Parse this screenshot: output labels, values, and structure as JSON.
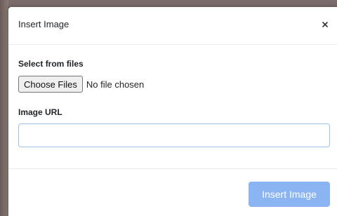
{
  "dialog": {
    "title": "Insert Image",
    "close_icon": "close-icon"
  },
  "files": {
    "label": "Select from files",
    "choose_button": "Choose Files",
    "status": "No file chosen"
  },
  "url": {
    "label": "Image URL",
    "value": "",
    "placeholder": ""
  },
  "footer": {
    "insert_button": "Insert Image",
    "insert_button_color": "#8bb4f2"
  }
}
